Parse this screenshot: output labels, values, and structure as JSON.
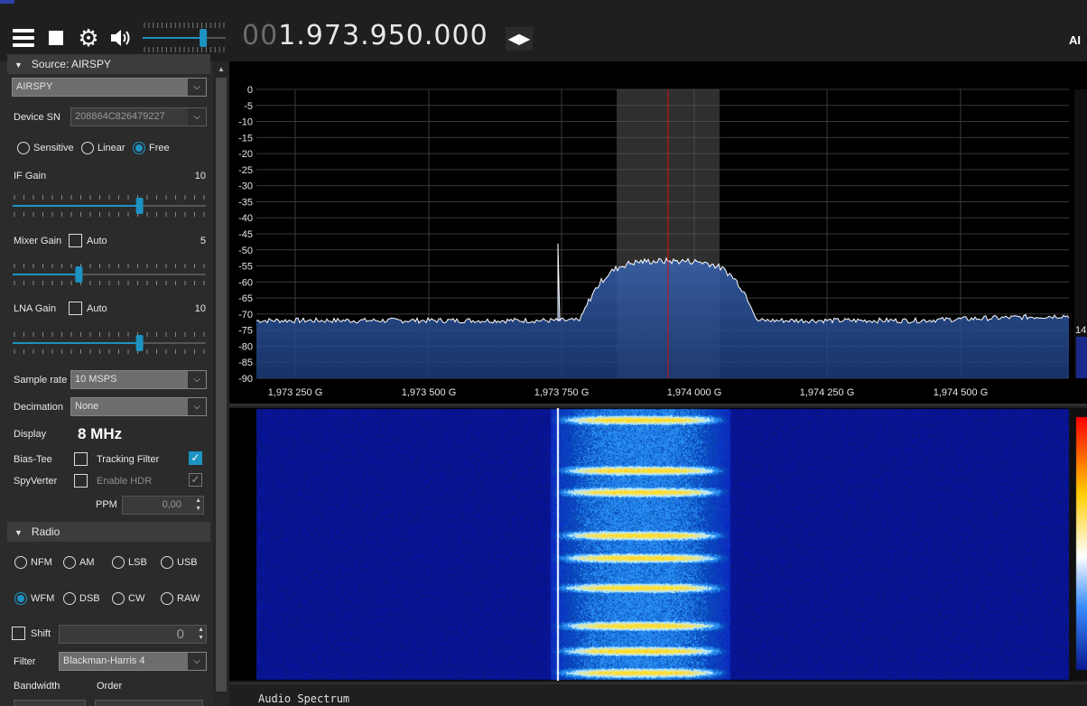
{
  "toolbar": {
    "frequency_dim": "00",
    "frequency_main": "1.973.950.000",
    "brand_stub": "AI",
    "icons": [
      "menu-icon",
      "stop-icon",
      "gear-icon",
      "speaker-icon",
      "swap-arrows-icon"
    ],
    "volume_level": 0.74
  },
  "source": {
    "header": "Source: AIRSPY",
    "device": "AIRSPY",
    "device_sn_label": "Device SN",
    "device_sn": "208864C826479227",
    "modes": [
      {
        "label": "Sensitive",
        "selected": false
      },
      {
        "label": "Linear",
        "selected": false
      },
      {
        "label": "Free",
        "selected": true
      }
    ],
    "if_gain_label": "IF Gain",
    "if_gain_value": "10",
    "if_gain_level": 0.66,
    "mixer_gain_label": "Mixer Gain",
    "mixer_gain_value": "5",
    "mixer_gain_level": 0.34,
    "lna_gain_label": "LNA Gain",
    "lna_gain_value": "10",
    "lna_gain_level": 0.66,
    "auto_label": "Auto",
    "sample_rate_label": "Sample rate",
    "sample_rate": "10 MSPS",
    "decimation_label": "Decimation",
    "decimation": "None",
    "display_label": "Display",
    "display_value": "8 MHz",
    "bias_tee_label": "Bias-Tee",
    "tracking_filter_label": "Tracking Filter",
    "spyverter_label": "SpyVerter",
    "enable_hdr_label": "Enable HDR",
    "ppm_label": "PPM",
    "ppm_value": "0,00"
  },
  "radio": {
    "header": "Radio",
    "modes_row1": [
      {
        "label": "NFM",
        "selected": false
      },
      {
        "label": "AM",
        "selected": false
      },
      {
        "label": "LSB",
        "selected": false
      },
      {
        "label": "USB",
        "selected": false
      }
    ],
    "modes_row2": [
      {
        "label": "WFM",
        "selected": true
      },
      {
        "label": "DSB",
        "selected": false
      },
      {
        "label": "CW",
        "selected": false
      },
      {
        "label": "RAW",
        "selected": false
      }
    ],
    "shift_label": "Shift",
    "shift_value": "0",
    "filter_label": "Filter",
    "filter_value": "Blackman-Harris 4",
    "bandwidth_label": "Bandwidth",
    "order_label": "Order"
  },
  "spectrum": {
    "y_ticks": [
      "0",
      "-5",
      "-10",
      "-15",
      "-20",
      "-25",
      "-30",
      "-35",
      "-40",
      "-45",
      "-50",
      "-55",
      "-60",
      "-65",
      "-70",
      "-75",
      "-80",
      "-85",
      "-90"
    ],
    "x_ticks": [
      "1,973 250 G",
      "1,973 500 G",
      "1,973 750 G",
      "1,974 000 G",
      "1,974 250 G",
      "1,974 500 G"
    ],
    "right_stub": "14",
    "colors": {
      "trace": "#ffffff",
      "fill": "#1b3b78",
      "center_line": "#d01010",
      "passband": "#555555"
    }
  },
  "audio_spectrum_label": "Audio Spectrum"
}
